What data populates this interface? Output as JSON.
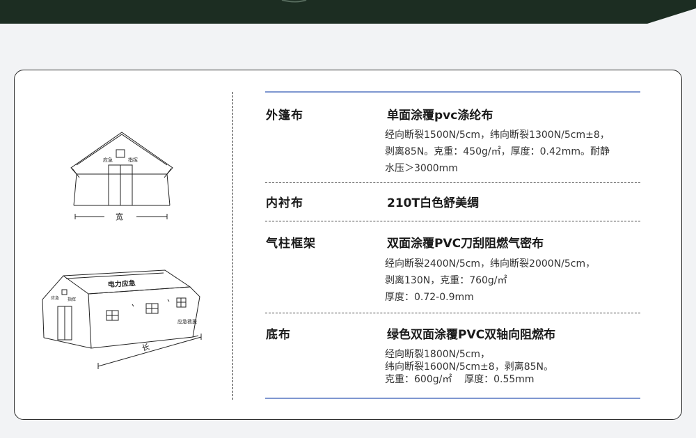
{
  "colors": {
    "top_band": "#1c2d22",
    "accent_rule": "#7f97d0",
    "background": "#f2f3f5"
  },
  "illustrations": {
    "front": {
      "sign_left": "应急",
      "sign_right": "指挥",
      "dimension_label": "宽"
    },
    "side": {
      "roof_text": "电力应急",
      "door_sign_left": "应急",
      "door_sign_right": "指挥",
      "side_sign": "应急救援",
      "dimension_label": "长"
    }
  },
  "specs": [
    {
      "label": "外篷布",
      "title": "单面涂覆pvc涤纶布",
      "lines": [
        "经向断裂1500N/5cm，纬向断裂1300N/5cm±8，",
        "剥离85N。克重：450g/㎡，厚度：0.42mm。耐静",
        "水压＞3000mm"
      ]
    },
    {
      "label": "内衬布",
      "title": "210T白色舒美绸",
      "lines": []
    },
    {
      "label": "气柱框架",
      "title": "双面涂覆PVC刀刮阻燃气密布",
      "lines": [
        "经向断裂2400N/5cm，纬向断裂2000N/5cm，",
        "剥离130N，克重：760g/㎡",
        "厚度：0.72-0.9mm"
      ]
    },
    {
      "label": "底布",
      "title": "绿色双面涂覆PVC双轴向阻燃布",
      "lines": [
        "经向断裂1800N/5cm，",
        "纬向断裂1600N/5cm±8，剥离85N。",
        "克重：600g/㎡    厚度：0.55mm"
      ]
    }
  ]
}
